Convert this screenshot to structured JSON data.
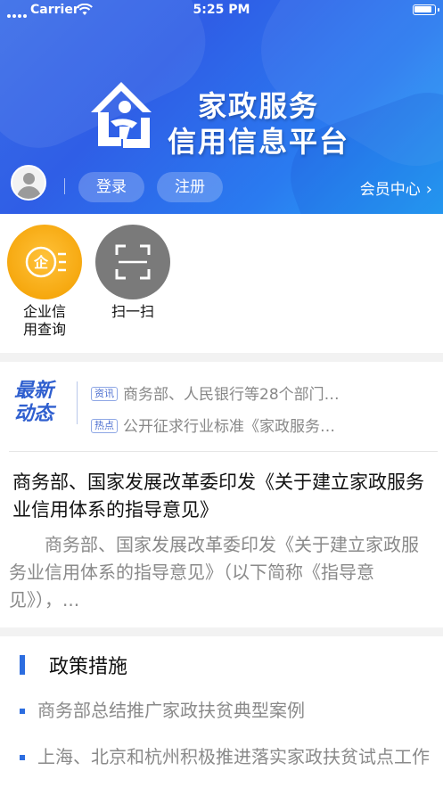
{
  "status_bar": {
    "carrier": "Carrier",
    "time": "5:25 PM"
  },
  "header": {
    "logo_line1": "家政服务",
    "logo_line2": "信用信息平台",
    "login": "登录",
    "register": "注册",
    "member_center": "会员中心"
  },
  "quick_entries": [
    {
      "label_line1": "企业信",
      "label_line2": "用查询",
      "icon": "enterprise-credit-icon",
      "color": "#f6a80f"
    },
    {
      "label_line1": "扫一扫",
      "label_line2": "",
      "icon": "scan-icon",
      "color": "#7a7a7a"
    }
  ],
  "news": {
    "logo_line1": "最新",
    "logo_line2": "动态",
    "ticker": [
      {
        "tag": "资讯",
        "text": "商务部、人民银行等28个部门…"
      },
      {
        "tag": "热点",
        "text": "公开征求行业标准《家政服务…"
      }
    ],
    "article_title": "商务部、国家发展改革委印发《关于建立家政服务业信用体系的指导意见》",
    "article_summary": "商务部、国家发展改革委印发《关于建立家政服务业信用体系的指导意见》（以下简称《指导意见》），..."
  },
  "policy": {
    "title": "政策措施",
    "items": [
      "商务部总结推广家政扶贫典型案例",
      "上海、北京和杭州积极推进落实家政扶贫试点工作"
    ]
  },
  "colors": {
    "accent": "#2c6de0",
    "header_start": "#3a6de8",
    "header_end": "#27a8f8"
  }
}
